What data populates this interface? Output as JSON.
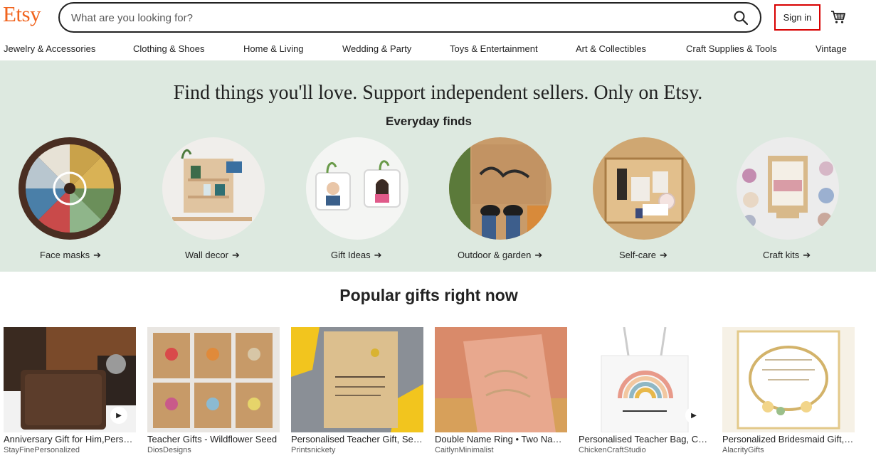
{
  "header": {
    "logo": "Etsy",
    "search_placeholder": "What are you looking for?",
    "search_icon": "search-icon",
    "signin_label": "Sign in",
    "cart_icon": "cart-icon"
  },
  "categories": [
    "Jewelry & Accessories",
    "Clothing & Shoes",
    "Home & Living",
    "Wedding & Party",
    "Toys & Entertainment",
    "Art & Collectibles",
    "Craft Supplies & Tools",
    "Vintage"
  ],
  "hero": {
    "title": "Find things you'll love. Support independent sellers. Only on Etsy.",
    "subtitle": "Everyday finds",
    "arrow": "➔",
    "items": [
      {
        "label": "Face masks"
      },
      {
        "label": "Wall decor"
      },
      {
        "label": "Gift Ideas"
      },
      {
        "label": "Outdoor & garden"
      },
      {
        "label": "Self-care"
      },
      {
        "label": "Craft kits"
      }
    ]
  },
  "popular": {
    "title": "Popular gifts right now",
    "play_icon": "play-icon",
    "items": [
      {
        "name": "Anniversary Gift for Him,Personalized",
        "shop": "StayFinePersonalized",
        "has_video": true
      },
      {
        "name": "Teacher Gifts - Wildflower Seed",
        "shop": "DiosDesigns",
        "has_video": false
      },
      {
        "name": "Personalised Teacher Gift, Seed",
        "shop": "Printsnickety",
        "has_video": false
      },
      {
        "name": "Double Name Ring • Two Name Ring",
        "shop": "CaitlynMinimalist",
        "has_video": false
      },
      {
        "name": "Personalised Teacher Bag, Cotton",
        "shop": "ChickenCraftStudio",
        "has_video": true
      },
      {
        "name": "Personalized Bridesmaid Gift, Bracelet",
        "shop": "AlacrityGifts",
        "has_video": false
      }
    ]
  },
  "colors": {
    "brand": "#F1641E",
    "hero_bg": "#DDE9E0",
    "signin_highlight": "#d80000",
    "text": "#222222",
    "muted": "#595959"
  }
}
